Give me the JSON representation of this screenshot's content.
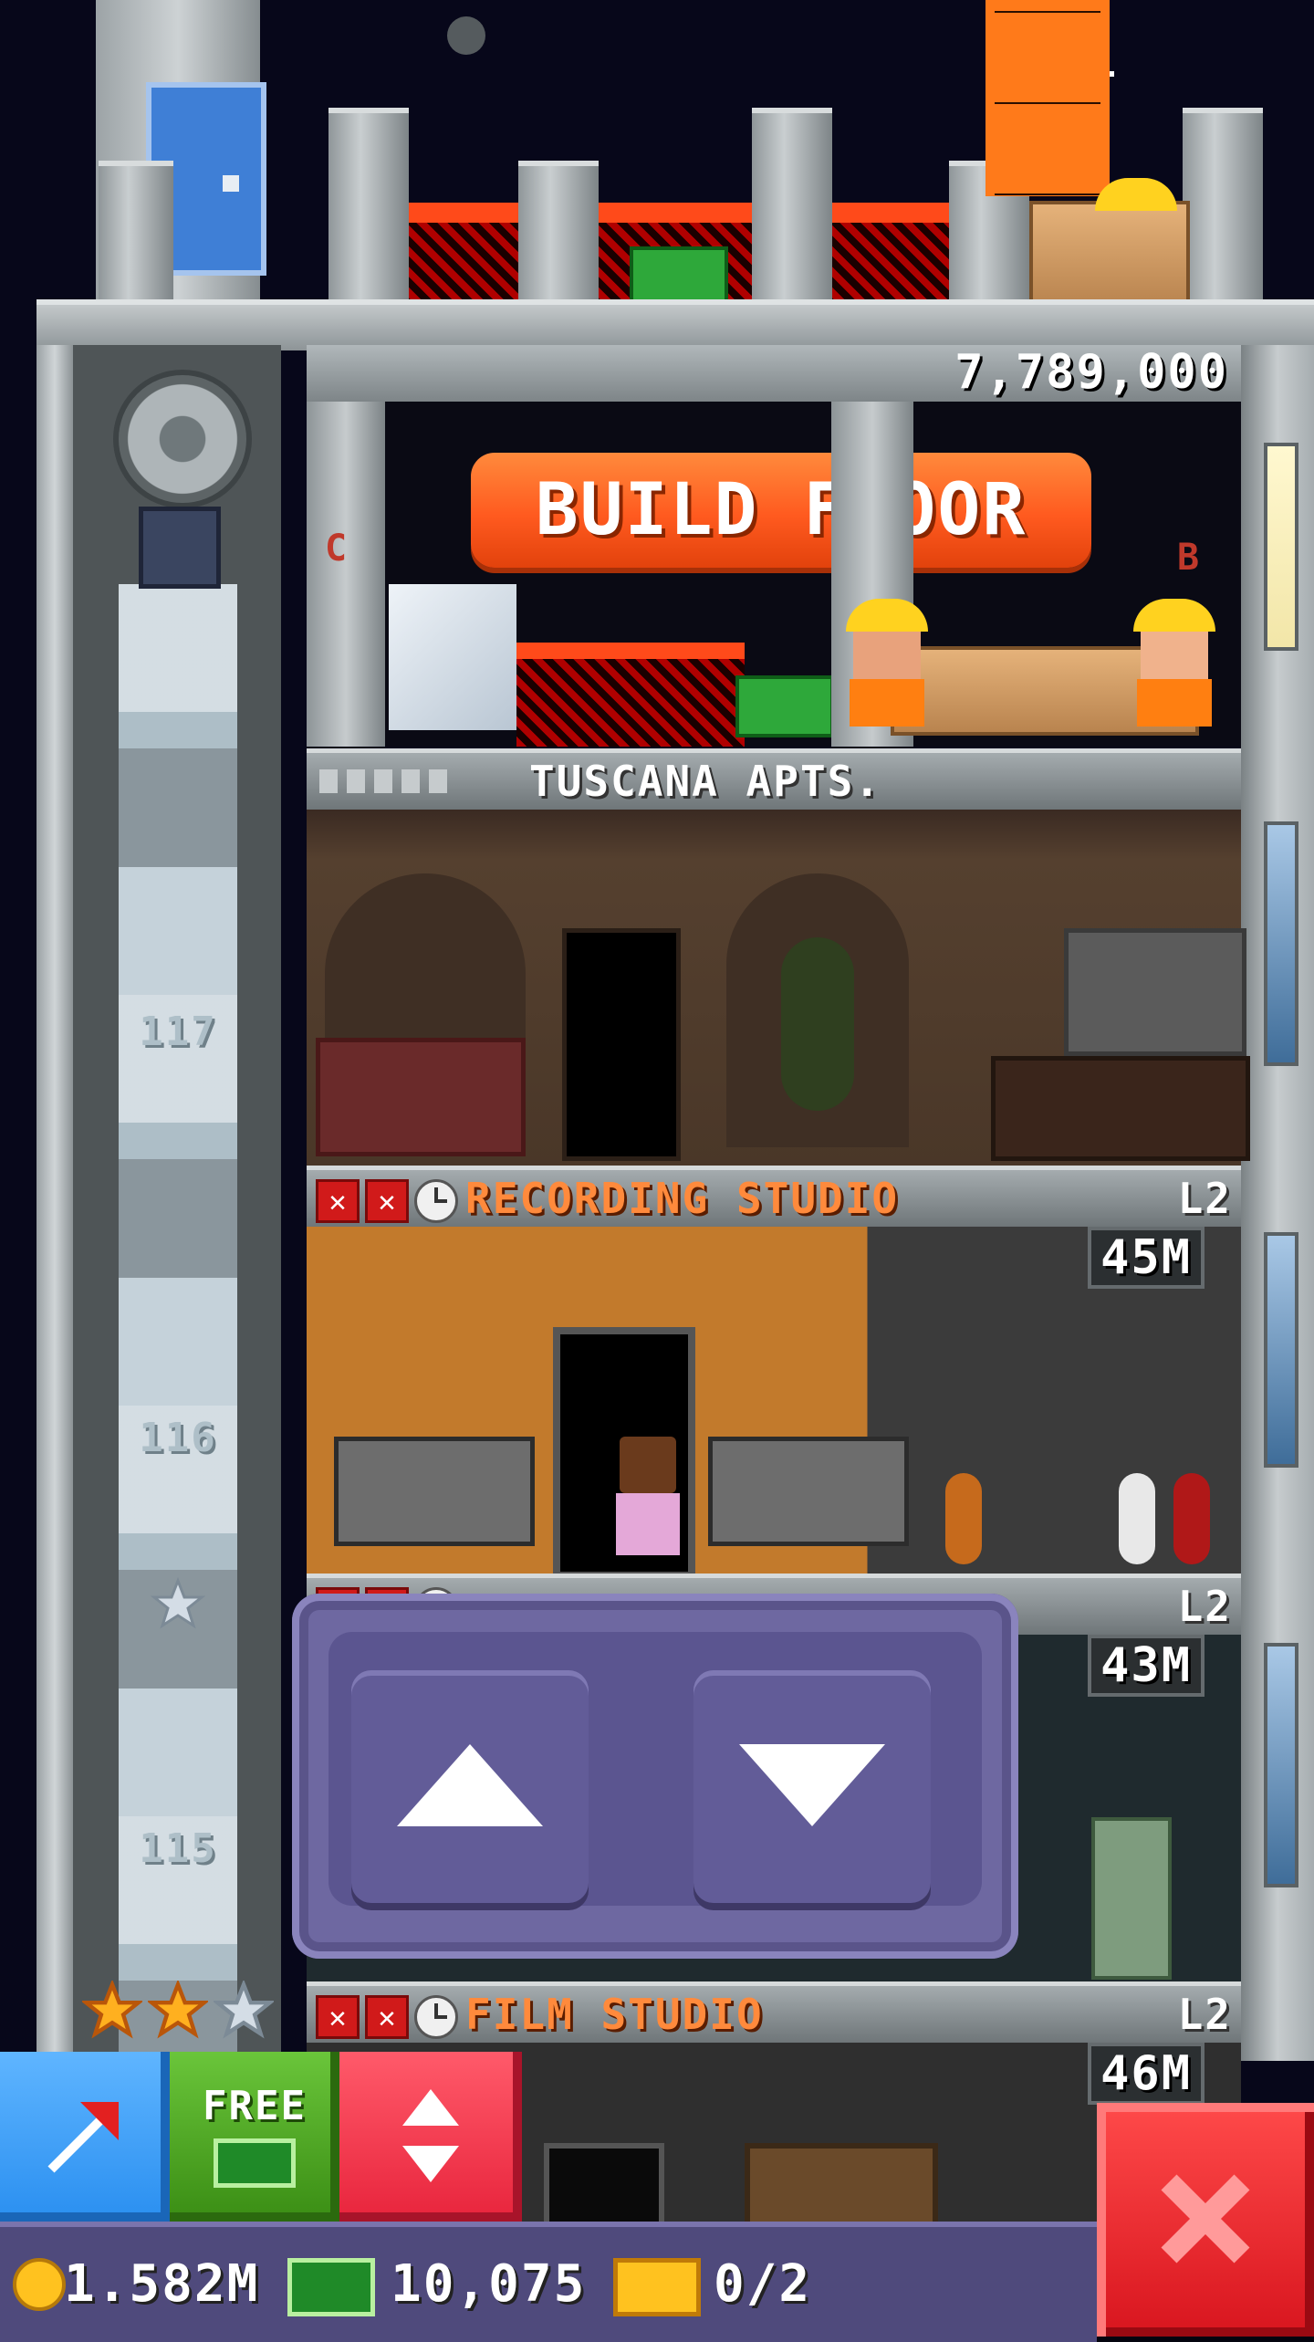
{
  "construction": {
    "cost": "7,789,000",
    "build_label": "BUILD FLOOR",
    "sign_left_letter": "C",
    "sign_right_letter": "B"
  },
  "floors": [
    {
      "name": "TUSCANA APTS.",
      "level": "",
      "price": "",
      "type": "residential"
    },
    {
      "name": "RECORDING STUDIO",
      "level": "L2",
      "price": "45M",
      "type": "business"
    },
    {
      "name": "",
      "level": "L2",
      "price": "43M",
      "type": "business"
    },
    {
      "name": "FILM STUDIO",
      "level": "L2",
      "price": "46M",
      "type": "business"
    }
  ],
  "elevator": {
    "floor_numbers": [
      "117",
      "116",
      "115"
    ]
  },
  "elevator_controls": {
    "up_icon": "triangle-up-icon",
    "down_icon": "triangle-down-icon"
  },
  "toolbar": {
    "free_label": "FREE",
    "close_icon": "x-icon"
  },
  "status": {
    "coins": "1.582M",
    "bux": "10,075",
    "tickets": "0/2"
  },
  "colors": {
    "build_button": "#ff5a1f",
    "floor_name": "#ff8a3c",
    "elevator_panel": "#5e578f",
    "raise_button": "#2a8ff0",
    "free_button": "#4aa51c",
    "elevator_button": "#e8243c",
    "close_button": "#e01c28"
  }
}
